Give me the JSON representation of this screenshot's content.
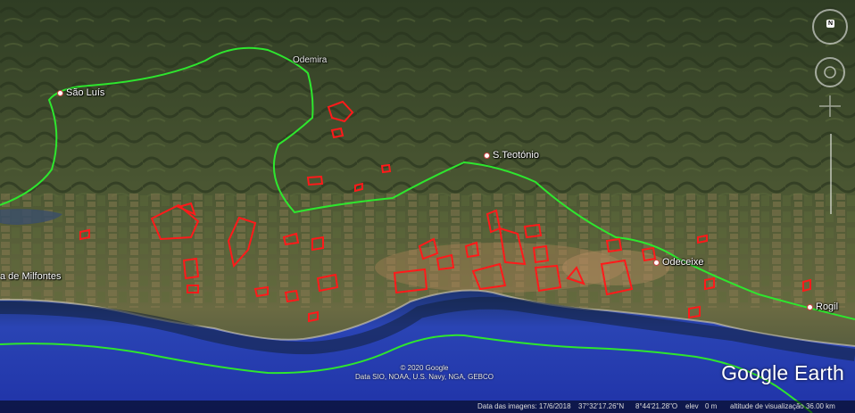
{
  "colors": {
    "road": "#2ee62e",
    "parcel": "#ff1a1a",
    "ocean": "#2a42b8",
    "ocean_deep": "#1e2f8c",
    "coast_shadow": "#15253a"
  },
  "places": {
    "sao_luis": "São Luís",
    "odemira": "Odemira",
    "s_teotonio": "S.Teotónio",
    "milfontes": "a de Milfontes",
    "odeceixe": "Odeceixe",
    "rogil": "Rogil"
  },
  "credit": {
    "line1": "© 2020 Google",
    "line2": "Data SIO, NOAA, U.S. Navy, NGA, GEBCO"
  },
  "brand": "Google Earth",
  "status": {
    "imagery_date": "Data das imagens: 17/6/2018",
    "lat": "37°32'17.26\"N",
    "lon": "8°44'21.28\"O",
    "elev_label": "elev",
    "elev_value": "0 m",
    "eye_alt": "altitude de visualização  36.00 km"
  },
  "nav": {
    "compass_label": "N",
    "compass_icon": "compass-icon",
    "look_icon": "look-joystick-icon",
    "move_icon": "move-joystick-icon",
    "zoom_icon": "zoom-slider-icon"
  }
}
